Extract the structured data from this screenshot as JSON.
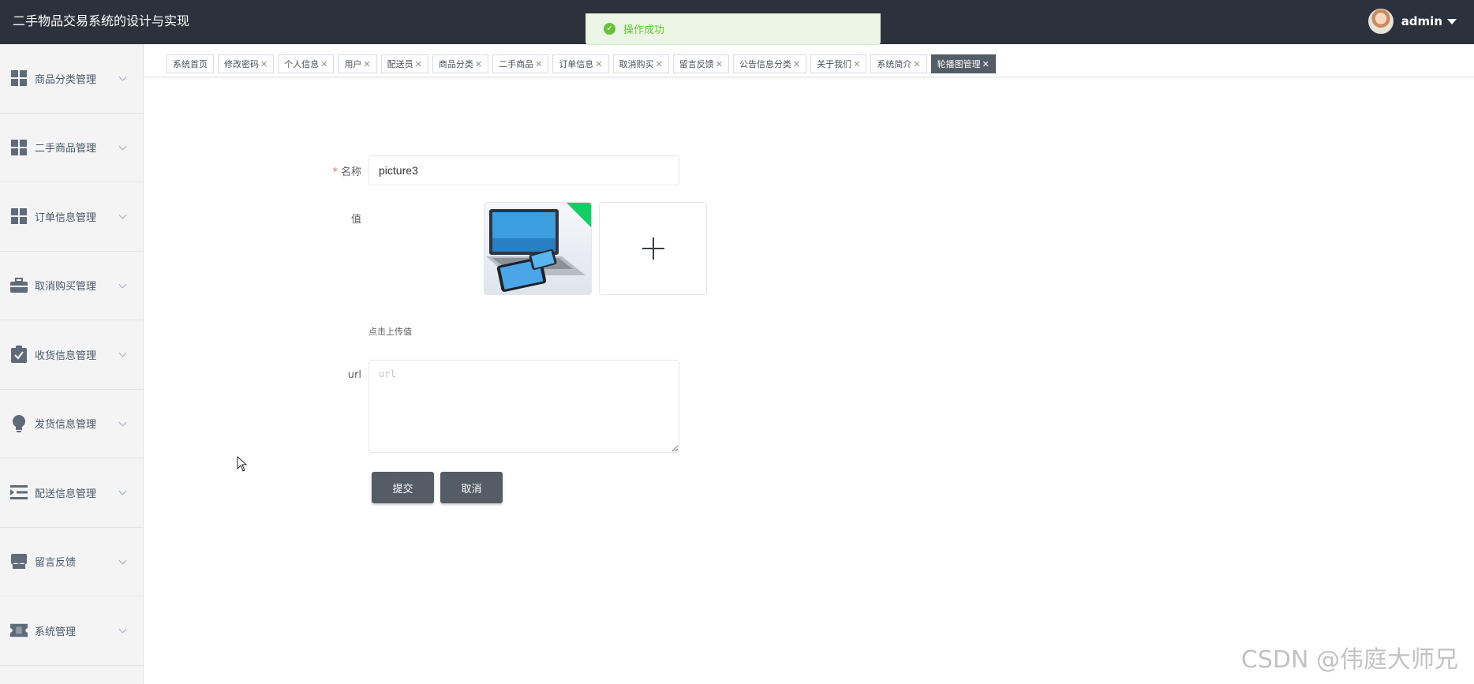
{
  "header": {
    "app_title": "二手物品交易系统的设计与实现",
    "username": "admin"
  },
  "toast": {
    "text": "操作成功",
    "color": "#67c23a"
  },
  "sidebar": {
    "items": [
      {
        "label": "商品分类管理",
        "icon": "grid-icon"
      },
      {
        "label": "二手商品管理",
        "icon": "grid-icon"
      },
      {
        "label": "订单信息管理",
        "icon": "grid-icon"
      },
      {
        "label": "取消购买管理",
        "icon": "briefcase-icon"
      },
      {
        "label": "收货信息管理",
        "icon": "clipboard-check-icon"
      },
      {
        "label": "发货信息管理",
        "icon": "lightbulb-icon"
      },
      {
        "label": "配送信息管理",
        "icon": "list-indent-icon"
      },
      {
        "label": "留言反馈",
        "icon": "shop-icon"
      },
      {
        "label": "系统管理",
        "icon": "ticket-icon"
      }
    ]
  },
  "tabs": [
    {
      "label": "系统首页",
      "closable": false
    },
    {
      "label": "修改密码",
      "closable": true
    },
    {
      "label": "个人信息",
      "closable": true
    },
    {
      "label": "用户",
      "closable": true
    },
    {
      "label": "配送员",
      "closable": true
    },
    {
      "label": "商品分类",
      "closable": true
    },
    {
      "label": "二手商品",
      "closable": true
    },
    {
      "label": "订单信息",
      "closable": true
    },
    {
      "label": "取消购买",
      "closable": true
    },
    {
      "label": "留言反馈",
      "closable": true
    },
    {
      "label": "公告信息分类",
      "closable": true
    },
    {
      "label": "关于我们",
      "closable": true
    },
    {
      "label": "系统简介",
      "closable": true
    },
    {
      "label": "轮播图管理",
      "closable": true,
      "active": true
    }
  ],
  "form": {
    "name_label": "名称",
    "name_value": "picture3",
    "value_label": "值",
    "upload_hint": "点击上传值",
    "url_label": "url",
    "url_placeholder": "url",
    "submit_label": "提交",
    "cancel_label": "取消"
  },
  "watermark": "CSDN @伟庭大师兄",
  "colors": {
    "header_bg": "#2b323c",
    "button_bg": "#545c66",
    "active_tab_bg": "#545c66",
    "required_star": "#f56c6c"
  }
}
